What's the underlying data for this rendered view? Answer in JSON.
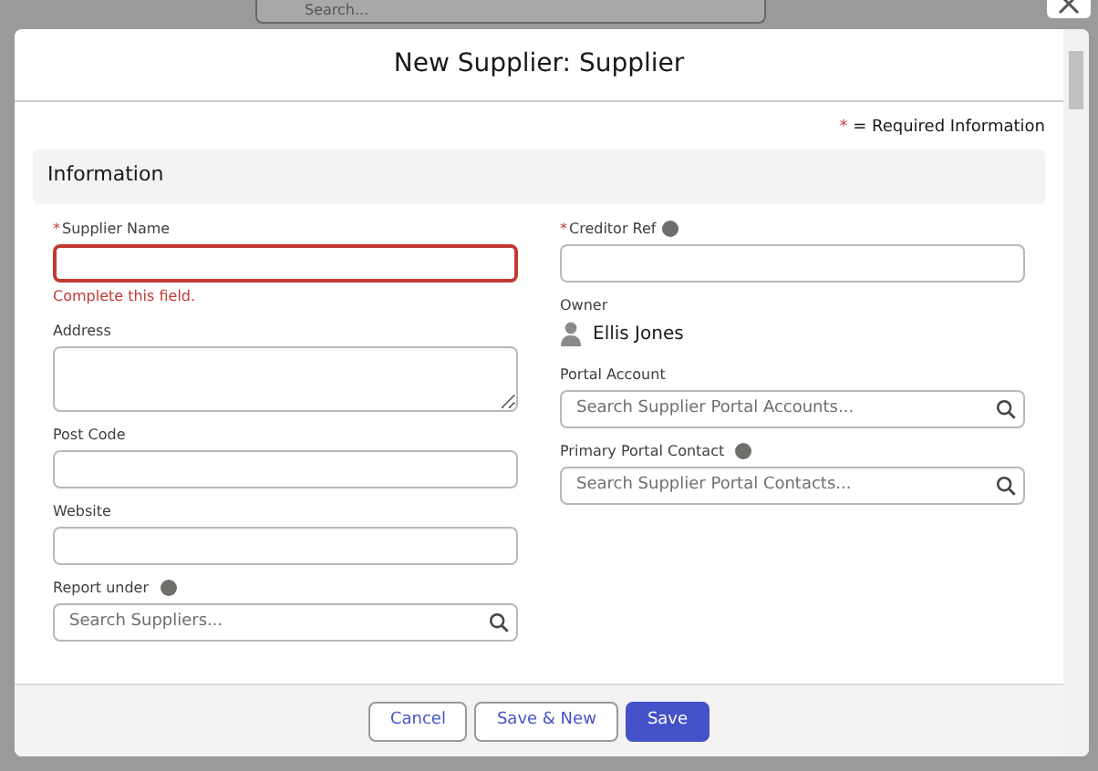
{
  "background": {
    "search": {
      "placeholder": "Search..."
    }
  },
  "modal": {
    "title": "New Supplier: Supplier",
    "required_note": {
      "mark": "*",
      "text": "= Required Information"
    },
    "section": {
      "title": "Information"
    },
    "left_column": [
      {
        "kind": "text",
        "label": "Supplier Name",
        "required": true,
        "info": false,
        "error": "Complete this field."
      },
      {
        "kind": "textarea",
        "label": "Address",
        "required": false,
        "info": false
      },
      {
        "kind": "text",
        "label": "Post Code",
        "required": false,
        "info": false
      },
      {
        "kind": "text",
        "label": "Website",
        "required": false,
        "info": false
      },
      {
        "kind": "lookup",
        "label": "Report under",
        "required": false,
        "info": true,
        "placeholder": "Search Suppliers..."
      }
    ],
    "right_column": [
      {
        "kind": "text",
        "label": "Creditor Ref",
        "required": true,
        "info": true
      },
      {
        "kind": "owner",
        "label": "Owner",
        "value": "Ellis Jones"
      },
      {
        "kind": "lookup",
        "label": "Portal Account",
        "required": false,
        "info": false,
        "placeholder": "Search Supplier Portal Accounts..."
      },
      {
        "kind": "lookup",
        "label": "Primary Portal Contact",
        "required": false,
        "info": true,
        "placeholder": "Search Supplier Portal Contacts..."
      }
    ],
    "buttons": [
      {
        "label": "Cancel",
        "kind": "neutral"
      },
      {
        "label": "Save & New",
        "kind": "neutral"
      },
      {
        "label": "Save",
        "kind": "brand"
      }
    ]
  }
}
